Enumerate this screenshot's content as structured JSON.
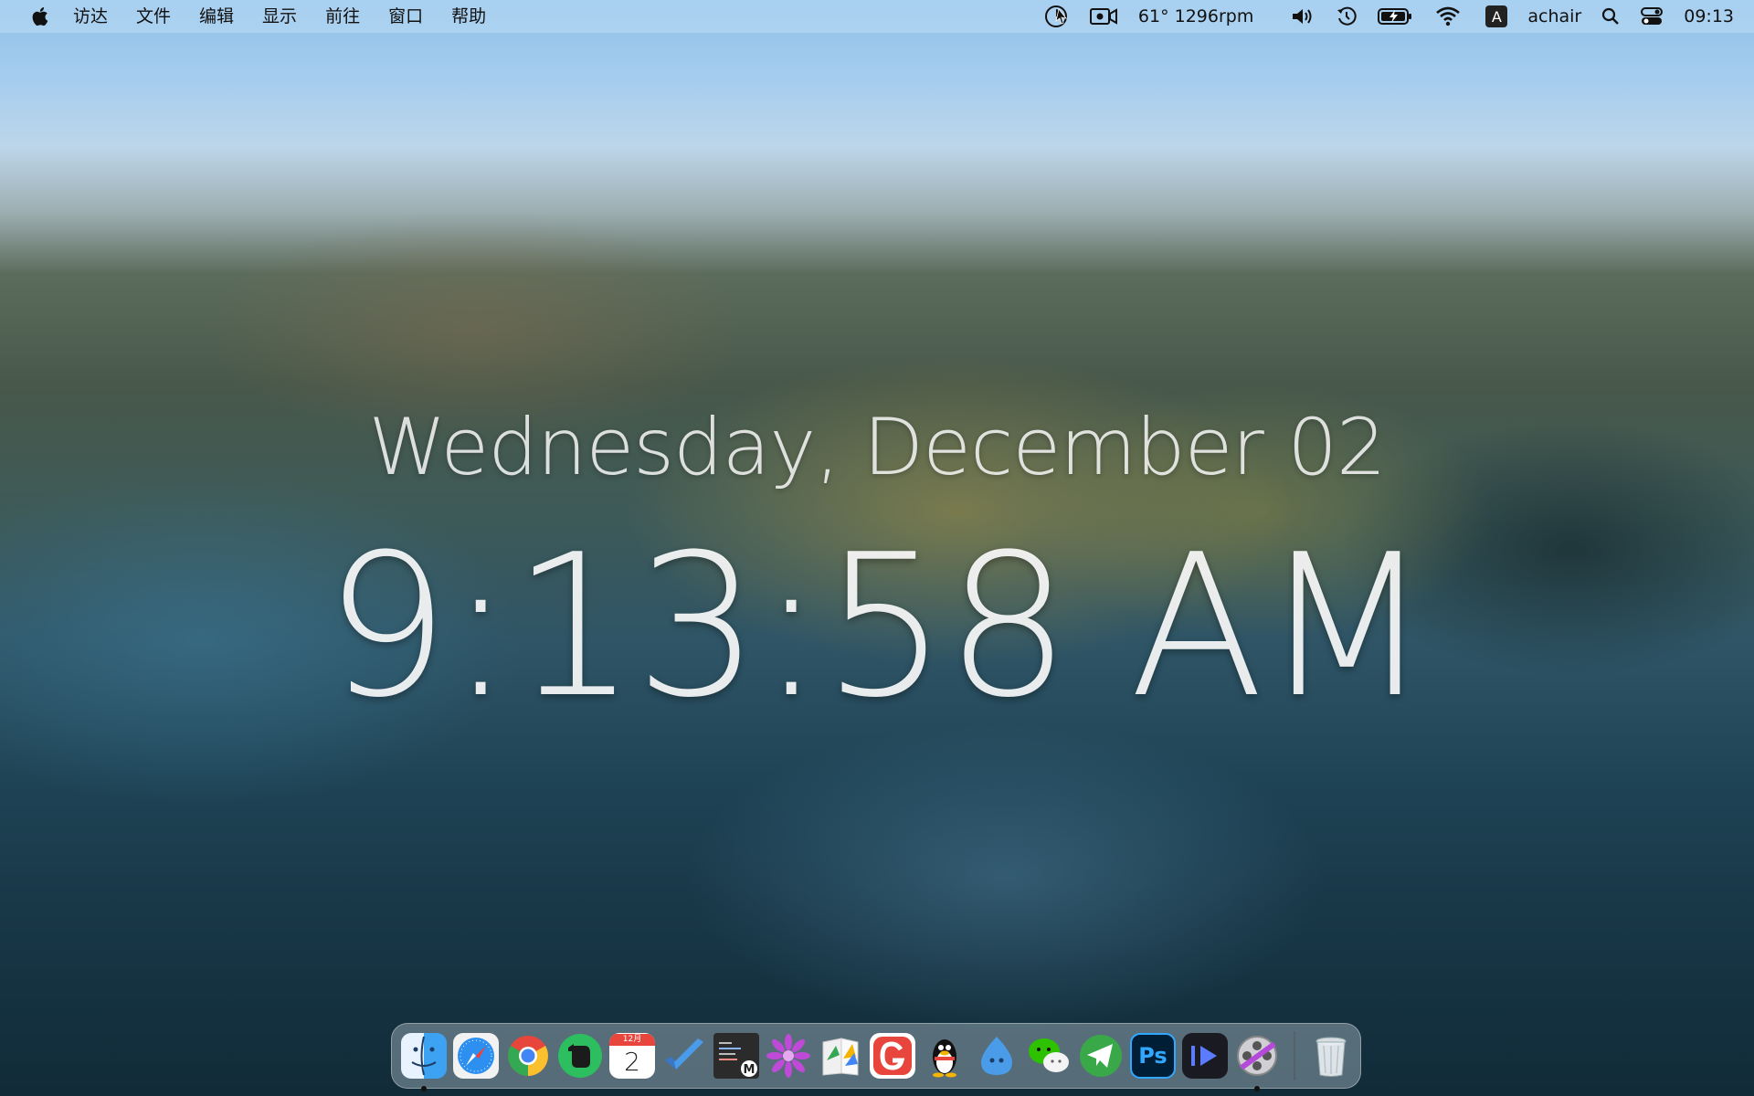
{
  "menubar": {
    "apple_icon": "apple-icon",
    "items": [
      {
        "label": "访达"
      },
      {
        "label": "文件"
      },
      {
        "label": "编辑"
      },
      {
        "label": "显示"
      },
      {
        "label": "前往"
      },
      {
        "label": "窗口"
      },
      {
        "label": "帮助"
      }
    ],
    "status": {
      "fan_readout": "61° 1296rpm",
      "input_source": "A",
      "username": "achair",
      "clock": "09:13"
    }
  },
  "overlay": {
    "date": "Wednesday, December 02",
    "time": "9:13:58 AM"
  },
  "dock": {
    "apps": [
      {
        "name": "finder-icon",
        "running": true
      },
      {
        "name": "safari-icon",
        "running": false
      },
      {
        "name": "chrome-icon",
        "running": false
      },
      {
        "name": "evernote-icon",
        "running": false
      },
      {
        "name": "calendar-icon",
        "running": false,
        "month": "12月",
        "day": "2"
      },
      {
        "name": "tasks-check-icon",
        "running": false
      },
      {
        "name": "editor-icon",
        "running": false
      },
      {
        "name": "flower-icon",
        "running": false
      },
      {
        "name": "notebook-icon",
        "running": false
      },
      {
        "name": "g-app-icon",
        "running": false
      },
      {
        "name": "qq-penguin-icon",
        "running": false
      },
      {
        "name": "droplet-chat-icon",
        "running": false
      },
      {
        "name": "wechat-icon",
        "running": false
      },
      {
        "name": "paper-plane-icon",
        "running": false
      },
      {
        "name": "photoshop-icon",
        "running": false,
        "label": "Ps"
      },
      {
        "name": "video-play-icon",
        "running": false
      },
      {
        "name": "film-reel-icon",
        "running": true
      },
      {
        "name": "trash-icon",
        "running": false
      }
    ],
    "colors": {
      "evernote": "#2dbe60",
      "calendar_red": "#e8453c",
      "ps_blue": "#31a8ff",
      "telegram": "#39a849"
    }
  }
}
